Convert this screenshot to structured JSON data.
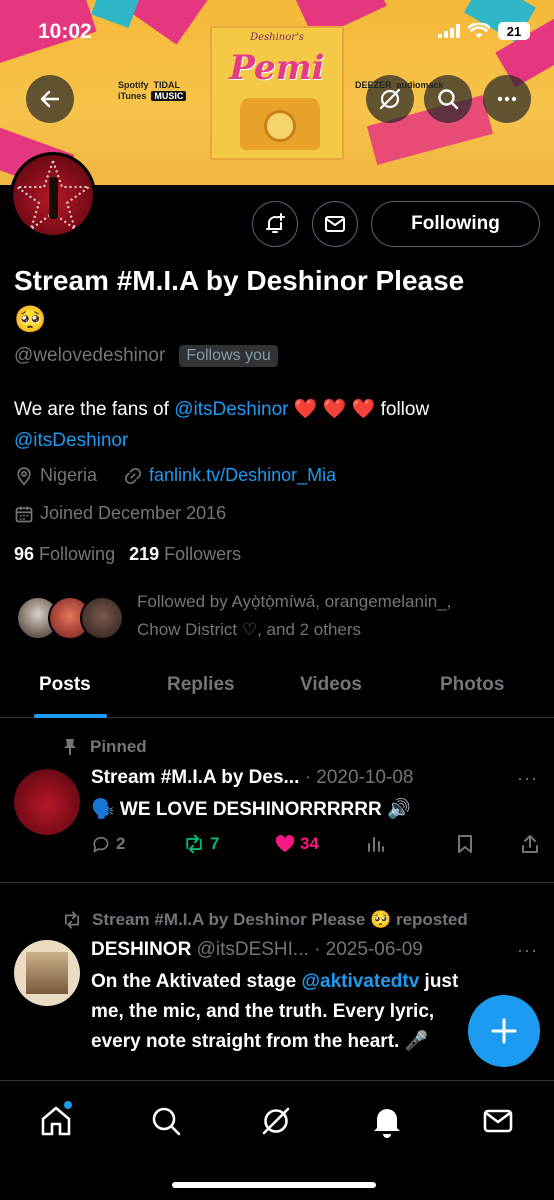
{
  "status_bar": {
    "time": "10:02",
    "battery": "21"
  },
  "banner": {
    "album_header": "Deshinor's",
    "album_title": "Pemi",
    "logos_left": [
      "Spotify",
      "TIDAL",
      "iTunes",
      "MUSIC"
    ],
    "logos_right": [
      "DEEZER",
      "audiomack"
    ]
  },
  "header_buttons": {
    "back": "back",
    "grok": "grok",
    "search": "search",
    "more": "more"
  },
  "profile": {
    "name": "Stream #M.I.A by Deshinor Please",
    "name_emoji": "🥺",
    "handle": "@welovedeshinor",
    "follows_you": "Follows you",
    "following_button": "Following",
    "bio_part1": "We are the fans of ",
    "bio_mention1": "@itsDeshinor",
    "bio_hearts": " ❤️ ❤️ ❤️ ",
    "bio_part2": "follow",
    "bio_mention2": "@itsDeshinor",
    "location": "Nigeria",
    "website": "fanlink.tv/Deshinor_Mia",
    "joined": "Joined December 2016",
    "following_count": "96",
    "following_label": "Following",
    "followers_count": "219",
    "followers_label": "Followers",
    "followed_by_line1": "Followed by Ayọ̀tọ̀míwá, orangemelanin_,",
    "followed_by_line2": "Chow District ♡, and 2 others"
  },
  "tabs": [
    "Posts",
    "Replies",
    "Videos",
    "Photos"
  ],
  "pinned_label": "Pinned",
  "post1": {
    "author": "Stream #M.I.A by Des...",
    "date": "· 2020-10-08",
    "text": "🗣️ WE LOVE DESHINORRRRRR 🔊",
    "replies": "2",
    "reposts": "7",
    "likes": "34",
    "more": "···"
  },
  "post2": {
    "repost_label": "Stream #M.I.A by Deshinor Please 🥺 reposted",
    "author": "DESHINOR",
    "handle": "@itsDESHI...",
    "date": "· 2025-06-09",
    "line1_a": "On the Aktivated stage ",
    "line1_mention": "@aktivatedtv",
    "line1_b": "  just",
    "line2": "me, the mic, and the truth. Every lyric,",
    "line3": "every note straight from the heart. 🎤",
    "more": "···"
  },
  "colors": {
    "accent": "#1d9bf0",
    "like": "#f91880",
    "repost": "#00ba7c",
    "banner_yellow": "#f5b93a",
    "banner_pink": "#e5377f"
  }
}
